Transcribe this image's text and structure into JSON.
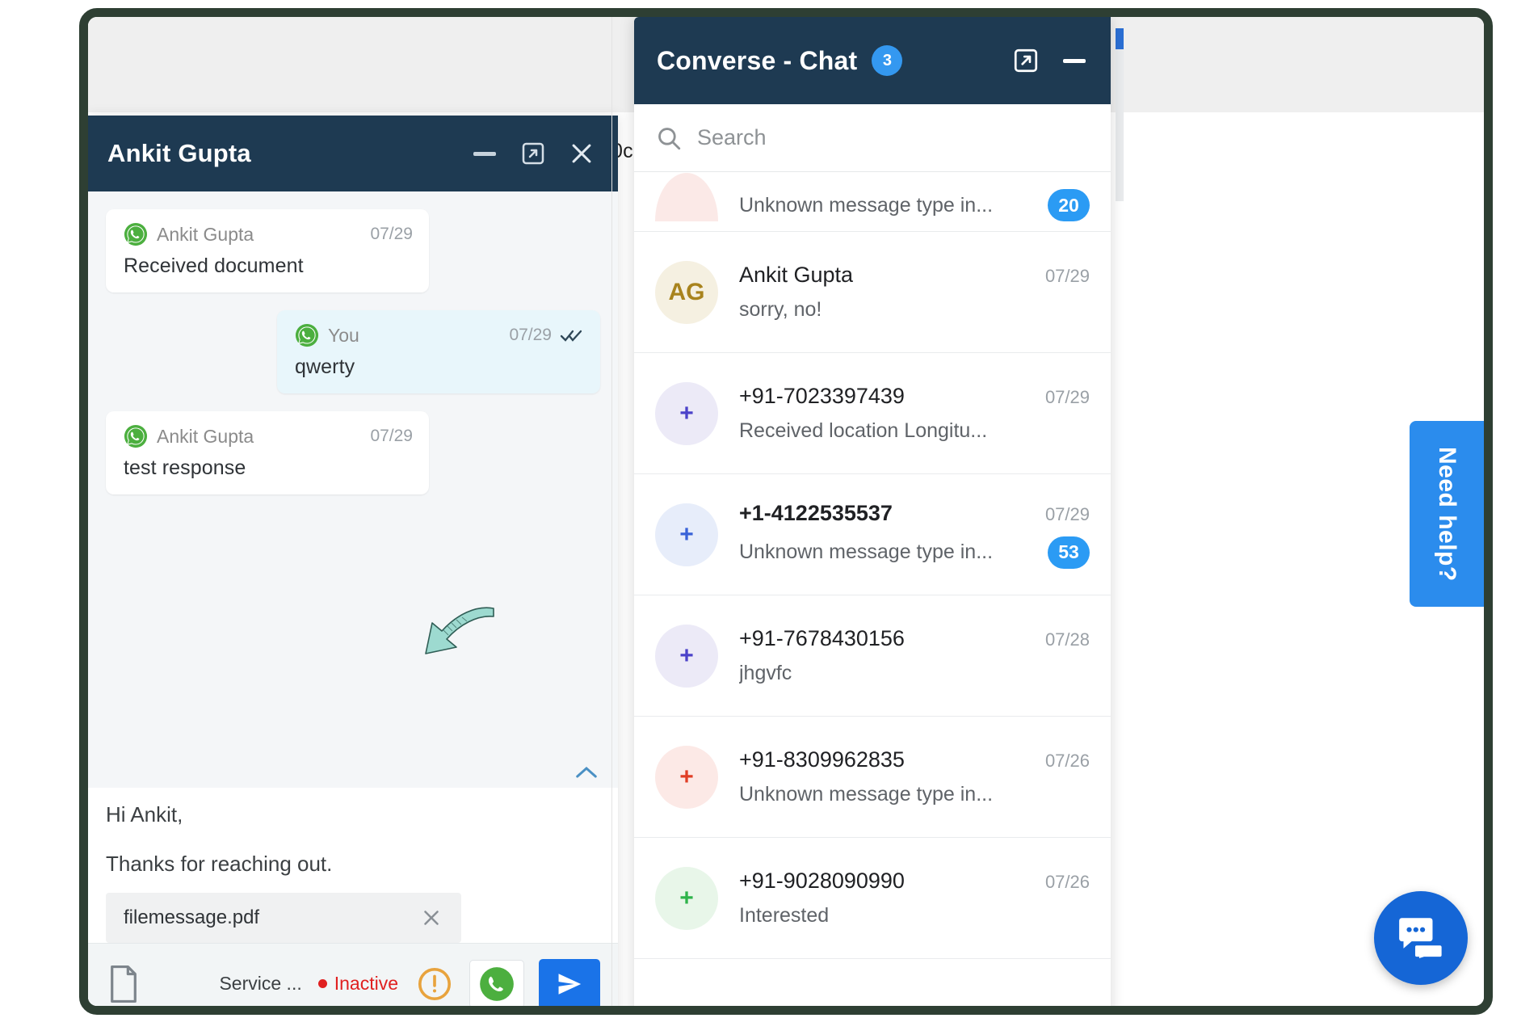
{
  "background": {
    "partial_text": "0c"
  },
  "chat_window": {
    "title": "Ankit Gupta",
    "controls": {
      "minimize": "minimize-icon",
      "popout": "popout-icon",
      "close": "close-icon"
    },
    "messages": [
      {
        "sender": "Ankit Gupta",
        "time": "07/29",
        "text": "Received document",
        "direction": "in",
        "channel_icon": "whatsapp-icon",
        "read_receipt": ""
      },
      {
        "sender": "You",
        "time": "07/29",
        "text": "qwerty",
        "direction": "out",
        "channel_icon": "whatsapp-icon",
        "read_receipt": "double-check-icon"
      },
      {
        "sender": "Ankit Gupta",
        "time": "07/29",
        "text": "test response",
        "direction": "in",
        "channel_icon": "whatsapp-icon",
        "read_receipt": ""
      }
    ],
    "composer": {
      "line1": "Hi Ankit,",
      "line2": "Thanks for reaching out.",
      "attachment": {
        "name": "filemessage.pdf",
        "remove_icon": "close-icon"
      }
    },
    "statusbar": {
      "file_icon": "document-icon",
      "service_label": "Service ...",
      "status_label": "Inactive",
      "status_color": "#e02020",
      "warning_icon": "warning-circle-icon",
      "channel_button": "whatsapp-icon",
      "send_button": "send-icon",
      "send_button_color": "#1a73e8"
    },
    "scroll_up_icon": "chevron-up-icon"
  },
  "converse_panel": {
    "title": "Converse - Chat",
    "badge": "3",
    "badge_color": "#3498f0",
    "controls": {
      "popout": "popout-icon",
      "minimize": "minimize-icon"
    },
    "search": {
      "icon": "search-icon",
      "placeholder": "Search",
      "value": ""
    },
    "rows": [
      {
        "name": "",
        "preview": "Unknown message type in...",
        "date": "",
        "unread": "20",
        "avatar_text": "",
        "avatar_bg": "#fbe9e7",
        "avatar_fg": "#d84315",
        "partial": true,
        "bold": false
      },
      {
        "name": "Ankit Gupta",
        "preview": "sorry, no!",
        "date": "07/29",
        "unread": "",
        "avatar_text": "AG",
        "avatar_bg": "#f5f0e1",
        "avatar_fg": "#a8831d",
        "partial": false,
        "bold": false
      },
      {
        "name": "+91-7023397439",
        "preview": "Received location Longitu...",
        "date": "07/29",
        "unread": "",
        "avatar_text": "+",
        "avatar_bg": "#eceaf7",
        "avatar_fg": "#4b42c9",
        "partial": false,
        "bold": false
      },
      {
        "name": "+1-4122535537",
        "preview": "Unknown message type in...",
        "date": "07/29",
        "unread": "53",
        "avatar_text": "+",
        "avatar_bg": "#e7edfa",
        "avatar_fg": "#3a63d8",
        "partial": false,
        "bold": true
      },
      {
        "name": "+91-7678430156",
        "preview": "jhgvfc",
        "date": "07/28",
        "unread": "",
        "avatar_text": "+",
        "avatar_bg": "#eceaf7",
        "avatar_fg": "#4b42c9",
        "partial": false,
        "bold": false
      },
      {
        "name": "+91-8309962835",
        "preview": "Unknown message type in...",
        "date": "07/26",
        "unread": "",
        "avatar_text": "+",
        "avatar_bg": "#fce9e6",
        "avatar_fg": "#e03e26",
        "partial": false,
        "bold": false
      },
      {
        "name": "+91-9028090990",
        "preview": "Interested",
        "date": "07/26",
        "unread": "",
        "avatar_text": "+",
        "avatar_bg": "#e8f6e9",
        "avatar_fg": "#2eb34a",
        "partial": false,
        "bold": false
      }
    ]
  },
  "help_tab": {
    "label": "Need help?",
    "color": "#2b8ced"
  },
  "fab": {
    "icon": "chat-bubble-icon",
    "color": "#1566d6"
  }
}
